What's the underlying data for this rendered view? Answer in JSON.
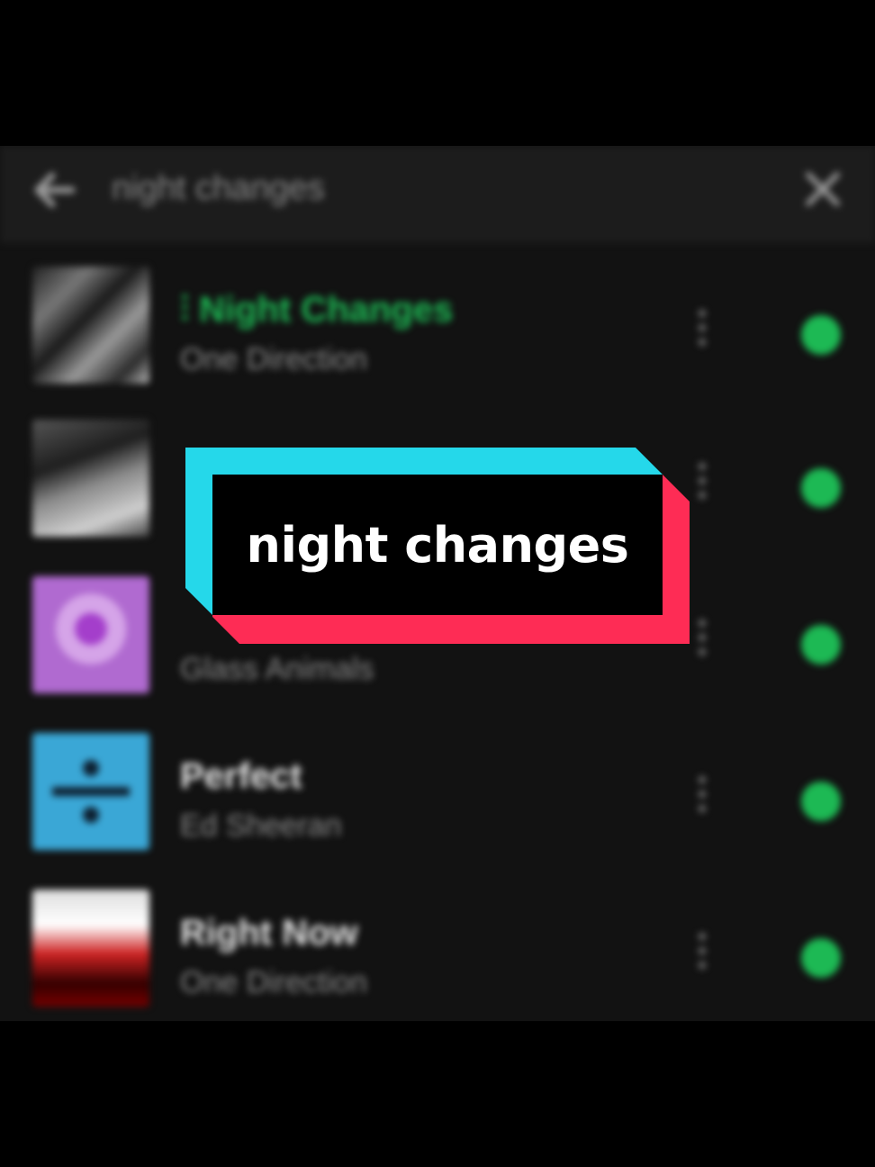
{
  "search": {
    "query": "night changes"
  },
  "results": [
    {
      "title": "Night Changes",
      "artist": "One Direction",
      "playing": true
    },
    {
      "title": "",
      "artist": ""
    },
    {
      "title": "",
      "artist": "Glass Animals"
    },
    {
      "title": "Perfect",
      "artist": "Ed Sheeran"
    },
    {
      "title": "Right Now",
      "artist": "One Direction"
    }
  ],
  "caption": {
    "text": "night changes"
  },
  "colors": {
    "accent": "#1db954",
    "caption_cyan": "#25d8ea",
    "caption_red": "#fe2c55"
  },
  "icons": {
    "back": "back-arrow-icon",
    "clear": "close-icon",
    "more": "more-vertical-icon",
    "download": "downloaded-icon",
    "playing": "equalizer-icon"
  }
}
